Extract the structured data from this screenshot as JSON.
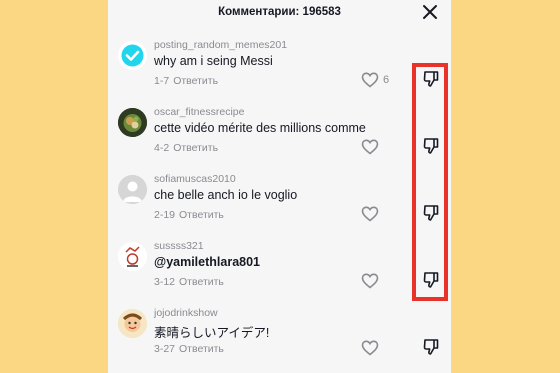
{
  "header": {
    "title": "Комментарии: 196583"
  },
  "comments": [
    {
      "username": "posting_random_memes201",
      "text": "why am i seing Messi",
      "date": "1-7",
      "reply_label": "Ответить",
      "like_count": "6",
      "avatar": "verified-check-avatar"
    },
    {
      "username": "oscar_fitnessrecipe",
      "text": "cette vidéo mérite des millions comme",
      "date": "4-2",
      "reply_label": "Ответить",
      "like_count": "",
      "avatar": "food-photo-avatar"
    },
    {
      "username": "sofiamuscas2010",
      "text": "che belle anch io le voglio",
      "date": "2-19",
      "reply_label": "Ответить",
      "like_count": "",
      "avatar": "default-user-avatar"
    },
    {
      "username": "sussss321",
      "text": "@yamilethlara801",
      "date": "3-12",
      "reply_label": "Ответить",
      "like_count": "",
      "avatar": "drawing-avatar"
    },
    {
      "username": "jojodrinkshow",
      "text": "素晴らしいアイデア!",
      "date": "3-27",
      "reply_label": "Ответить",
      "like_count": "",
      "avatar": "cartoon-avatar"
    }
  ],
  "colors": {
    "background": "#fbd683",
    "highlight": "#e8322a",
    "verified": "#20d5ec"
  }
}
